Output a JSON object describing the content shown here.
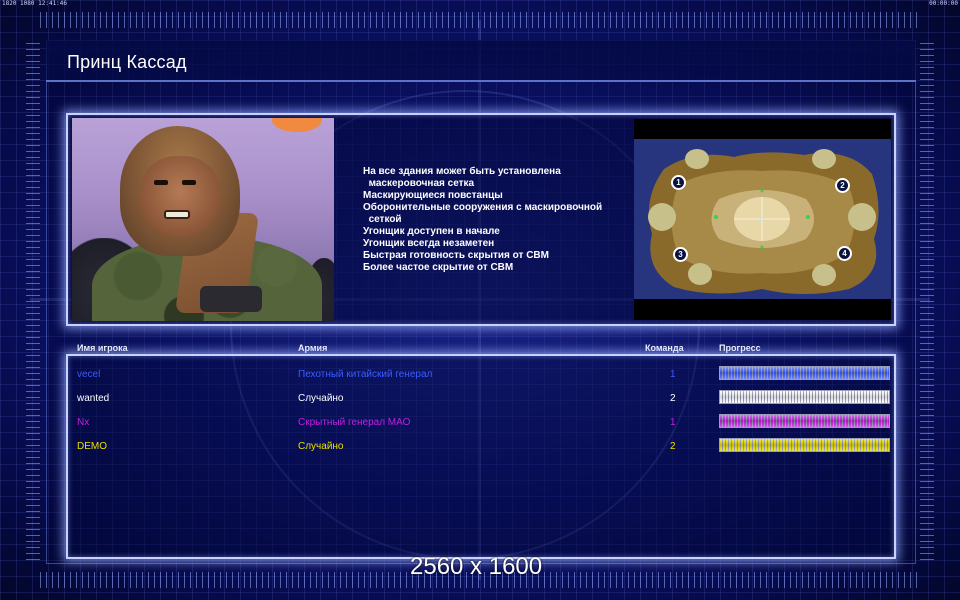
{
  "statusbar": {
    "left": "1820 1080 12:41:46",
    "right": "00:00:00"
  },
  "title": "Принц Кассад",
  "general": {
    "features": [
      "На все здания может быть установлена\n  маскеровочная сетка",
      "Маскирующиеся повстанцы",
      "Оборонительные сооружения с маскировочной\n  сеткой",
      "Угонщик доступен в начале",
      "Угонщик всегда незаметен",
      "Быстрая готовность скрытия от СВМ",
      "Более частое скрытие от СВМ"
    ]
  },
  "minimap": {
    "start_positions": [
      "1",
      "2",
      "3",
      "4"
    ]
  },
  "table": {
    "headers": {
      "player": "Имя игрока",
      "army": "Армия",
      "team": "Команда",
      "progress": "Прогресс"
    },
    "rows": [
      {
        "player": "vecel",
        "army": "Пехотный китайский генерал",
        "team": "1",
        "color": "#3a5cff",
        "progress": 1.0
      },
      {
        "player": "wanted",
        "army": "Случайно",
        "team": "2",
        "color": "#ffffff",
        "progress": 1.0
      },
      {
        "player": "Nx",
        "army": "Скрытный генерал МАО",
        "team": "1",
        "color": "#c020e0",
        "progress": 1.0
      },
      {
        "player": "DEMO",
        "army": "Случайно",
        "team": "2",
        "color": "#e8e000",
        "progress": 1.0
      }
    ]
  },
  "watermark": "2560 x 1600"
}
